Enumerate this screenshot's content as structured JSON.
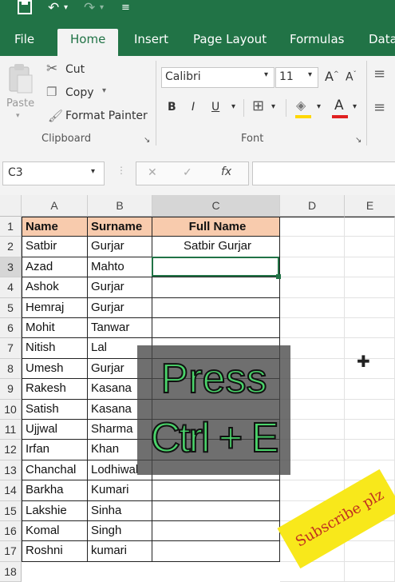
{
  "quick_access": {
    "save_icon": "save-icon",
    "undo_icon": "undo-icon",
    "redo_icon": "redo-icon",
    "customize_icon": "customize-icon"
  },
  "tabs": [
    "File",
    "Home",
    "Insert",
    "Page Layout",
    "Formulas",
    "Data"
  ],
  "clipboard": {
    "paste_label": "Paste",
    "cut_label": "Cut",
    "copy_label": "Copy",
    "format_painter_label": "Format Painter",
    "group_label": "Clipboard"
  },
  "font": {
    "font_name": "Calibri",
    "font_size": "11",
    "bold": "B",
    "italic": "I",
    "underline": "U",
    "group_label": "Font"
  },
  "formula_bar": {
    "name_box": "C3",
    "fx_label": "fx",
    "cancel_symbol": "✕",
    "enter_symbol": "✓",
    "value": ""
  },
  "columns": [
    "A",
    "B",
    "C",
    "D",
    "E"
  ],
  "rows": [
    {
      "num": "1",
      "a": "Name",
      "b": "Surname",
      "c": "Full Name"
    },
    {
      "num": "2",
      "a": "Satbir",
      "b": "Gurjar",
      "c": "Satbir Gurjar"
    },
    {
      "num": "3",
      "a": "Azad",
      "b": "Mahto",
      "c": ""
    },
    {
      "num": "4",
      "a": "Ashok",
      "b": "Gurjar",
      "c": ""
    },
    {
      "num": "5",
      "a": "Hemraj",
      "b": "Gurjar",
      "c": ""
    },
    {
      "num": "6",
      "a": "Mohit",
      "b": "Tanwar",
      "c": ""
    },
    {
      "num": "7",
      "a": "Nitish",
      "b": "Lal",
      "c": ""
    },
    {
      "num": "8",
      "a": "Umesh",
      "b": "Gurjar",
      "c": ""
    },
    {
      "num": "9",
      "a": "Rakesh",
      "b": "Kasana",
      "c": ""
    },
    {
      "num": "10",
      "a": "Satish",
      "b": "Kasana",
      "c": ""
    },
    {
      "num": "11",
      "a": "Ujjwal",
      "b": "Sharma",
      "c": ""
    },
    {
      "num": "12",
      "a": "Irfan",
      "b": "Khan",
      "c": ""
    },
    {
      "num": "13",
      "a": "Chanchal",
      "b": "Lodhiwal",
      "c": ""
    },
    {
      "num": "14",
      "a": "Barkha",
      "b": "Kumari",
      "c": ""
    },
    {
      "num": "15",
      "a": "Lakshie",
      "b": "Sinha",
      "c": ""
    },
    {
      "num": "16",
      "a": "Komal",
      "b": "Singh",
      "c": ""
    },
    {
      "num": "17",
      "a": "Roshni",
      "b": "kumari",
      "c": ""
    },
    {
      "num": "18",
      "a": "",
      "b": "",
      "c": ""
    }
  ],
  "overlay": {
    "line1": "Press",
    "line2": "Ctrl + E"
  },
  "sticker": "Subscribe plz",
  "colors": {
    "excel_green": "#217346",
    "header_fill": "#f8cbad",
    "overlay_text": "#4ad36a",
    "sticker_bg": "#f8e81b"
  }
}
